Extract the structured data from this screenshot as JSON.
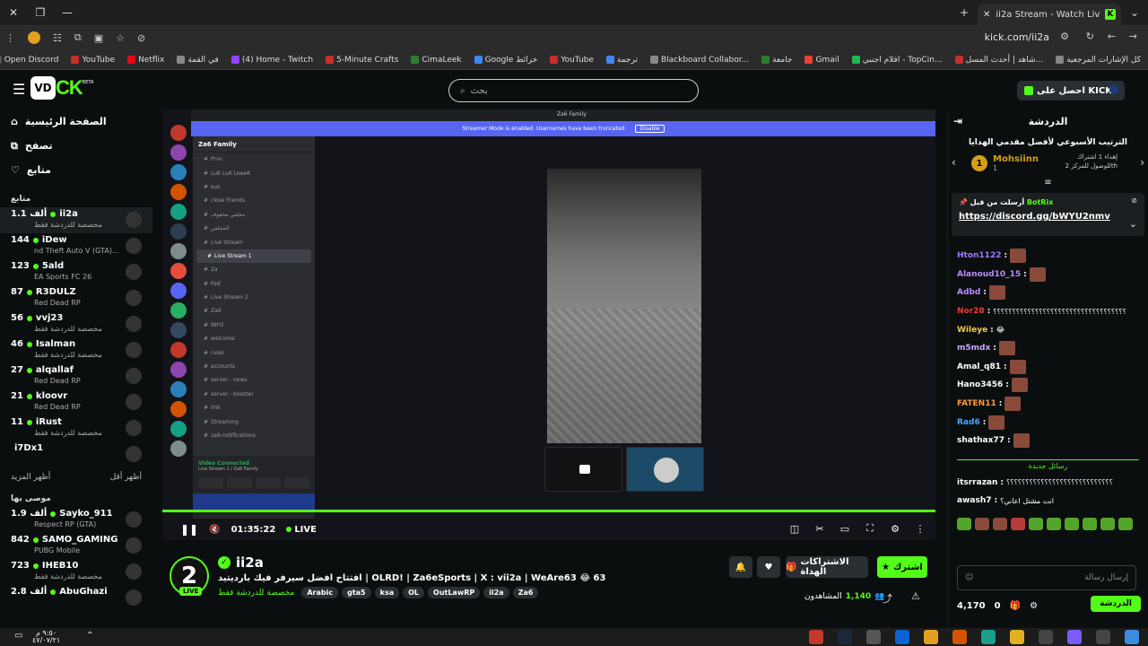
{
  "browser": {
    "tab_title": "ii2a Stream - Watch Live on Kick",
    "url": "kick.com/ii2a",
    "bookmarks": [
      "Open Discord",
      "YouTube",
      "Netflix",
      "في القمة",
      "(4) Home - Twitch",
      "5-Minute Crafts",
      "CimaLeek",
      "Google خرائط",
      "YouTube",
      "ترجمة",
      "Blackboard Collabor...",
      "جامعة",
      "Gmail",
      "افلام اجنبي - TopCin...",
      "شاهد | أحدث المسل...",
      "كل الإشارات المرجعية"
    ]
  },
  "header": {
    "logo_box": "VD",
    "logo_text": "CK",
    "logo_beta": "BETA",
    "search_placeholder": "بحث",
    "get_kicks": "احصل على KICKs"
  },
  "sidebar": {
    "nav": [
      {
        "label": "الصفحة الرئيسية",
        "icon": "home-icon"
      },
      {
        "label": "تصفح",
        "icon": "browse-icon"
      },
      {
        "label": "متابع",
        "icon": "heart-icon"
      }
    ],
    "following_label": "متابع",
    "channels": [
      {
        "name": "ii2a",
        "viewers": "1.1 ألف",
        "sub": "مخصصة للدردشة فقط",
        "active": true
      },
      {
        "name": "iDew",
        "viewers": "144",
        "sub": "nd Theft Auto V (GTA)...",
        "active": false
      },
      {
        "name": "5ald",
        "viewers": "123",
        "sub": "EA Sports FC 26",
        "active": false
      },
      {
        "name": "R3DULZ",
        "viewers": "87",
        "sub": "Red Dead RP",
        "active": false
      },
      {
        "name": "vvj23",
        "viewers": "56",
        "sub": "مخصصة للدردشة فقط",
        "active": false
      },
      {
        "name": "Isalman",
        "viewers": "46",
        "sub": "مخصصة للدردشة فقط",
        "active": false
      },
      {
        "name": "alqallaf",
        "viewers": "27",
        "sub": "Red Dead RP",
        "active": false
      },
      {
        "name": "kloovr",
        "viewers": "21",
        "sub": "Red Dead RP",
        "active": false
      },
      {
        "name": "iRust",
        "viewers": "11",
        "sub": "مخصصة للدردشة فقط",
        "active": false
      },
      {
        "name": "i7Dx1",
        "viewers": "",
        "sub": "",
        "active": false
      }
    ],
    "show_more": "أظهر المزيد",
    "show_less": "أظهر أقل",
    "recommended_label": "موصى بها",
    "recommended": [
      {
        "name": "Sayko_911",
        "viewers": "1.9 ألف",
        "sub": "Respect RP (GTA)"
      },
      {
        "name": "SAMO_GAMING",
        "viewers": "842",
        "sub": "PUBG Mobile"
      },
      {
        "name": "IHEB10",
        "viewers": "723",
        "sub": "مخصصة للدردشة فقط"
      },
      {
        "name": "AbuGhazi",
        "viewers": "2.8 ألف",
        "sub": ""
      }
    ]
  },
  "player": {
    "discord_title": "Za6 Family",
    "streamer_mode": "Streamer Mode is enabled. Usernames have been truncated.",
    "disable_label": "Disable",
    "server_name": "Za6 Family",
    "channels": [
      "Prvv",
      "LuK LuK LeeeK",
      "sus",
      "close friends",
      "مجلس مخفوف",
      "المجلس",
      "Live Stream",
      "Live Stream 1",
      "2a",
      "Fed",
      "Live Stream 2",
      "Za6",
      "INFO",
      "welcome",
      "rules",
      "accounts",
      "server - news",
      "server - booster",
      "link",
      "Streaming",
      "za6-notifications"
    ],
    "video_connected": "Video Connected",
    "video_sub": "Live Stream 1 / Za6 Family",
    "elapsed": "01:35:22",
    "live_label": "LIVE",
    "progress_fraction": 1.0
  },
  "stream": {
    "username": "ii2a",
    "live_badge": "LIVE",
    "title": "افتتاح افضل سيرفر فيك بارديتيد | OLRD! | Za6eSports | X : vii2a | WeAre63 😂 63",
    "category": "مخصصة للدردشة فقط",
    "tags": [
      "Arabic",
      "gta5",
      "ksa",
      "OL",
      "OutLawRP",
      "ii2a",
      "Za6"
    ],
    "subscribe_label": "اشترك",
    "gift_label": "الاشتراكات الهداة",
    "viewers_count": "1,140",
    "viewers_label": "المشاهدون"
  },
  "chat": {
    "header": "الدردشة",
    "weekly_title": "الترتيب الأسبوعي لأفضل مقدمي الهدايا",
    "top_gifter": "Mohsiinn",
    "top_gifter_count": "1",
    "top_rank": "1",
    "gift_note": "إهداء 1 اشتراك للوصول للمركز 2th",
    "pinned_by": "أرسلت من قبل",
    "pinned_user": "BotRix",
    "pinned_link": "https://discord.gg/bWYU2nmv",
    "messages": [
      {
        "user": "Hton1122",
        "color": "#9b7bff",
        "text": ""
      },
      {
        "user": "Alanoud10_15",
        "color": "#b98cff",
        "text": ""
      },
      {
        "user": "Adbd",
        "color": "#b98cff",
        "text": ""
      },
      {
        "user": "Nor28",
        "color": "#e03c3c",
        "text": "؟؟؟؟؟؟؟؟؟؟؟؟؟؟؟؟؟؟؟؟؟؟؟؟؟؟؟؟؟؟؟؟؟؟؟"
      },
      {
        "user": "Wileye",
        "color": "#f2c94c",
        "text": "😂"
      },
      {
        "user": "m5mdx",
        "color": "#c9a7ff",
        "text": ""
      },
      {
        "user": "Amal_q81",
        "color": "#ffffff",
        "text": ""
      },
      {
        "user": "Hano3456",
        "color": "#ffffff",
        "text": ""
      },
      {
        "user": "FATEN11",
        "color": "#ff9a3c",
        "text": ""
      },
      {
        "user": "Rad6",
        "color": "#4da3ff",
        "text": ""
      },
      {
        "user": "shathax77",
        "color": "#ffffff",
        "text": ""
      }
    ],
    "new_messages": "رسائل جديدة",
    "later_messages": [
      {
        "user": "itsrrazan",
        "color": "#ffffff",
        "text": "؟؟؟؟؟؟؟؟؟؟؟؟؟؟؟؟؟؟؟؟؟؟؟؟؟؟؟؟"
      },
      {
        "user": "awash7",
        "color": "#ffffff",
        "text": "انت مشتل اعاني؟"
      }
    ],
    "input_placeholder": "إرسال رسالة",
    "kicks_count": "4,170",
    "gifts_count": "0",
    "send_label": "الدردشة"
  },
  "taskbar": {
    "time": "٩:٥٠ م",
    "date": "٤٧/٠٧/٢١"
  },
  "colors": {
    "brand": "#53fc18",
    "discord": "#5865f2"
  }
}
